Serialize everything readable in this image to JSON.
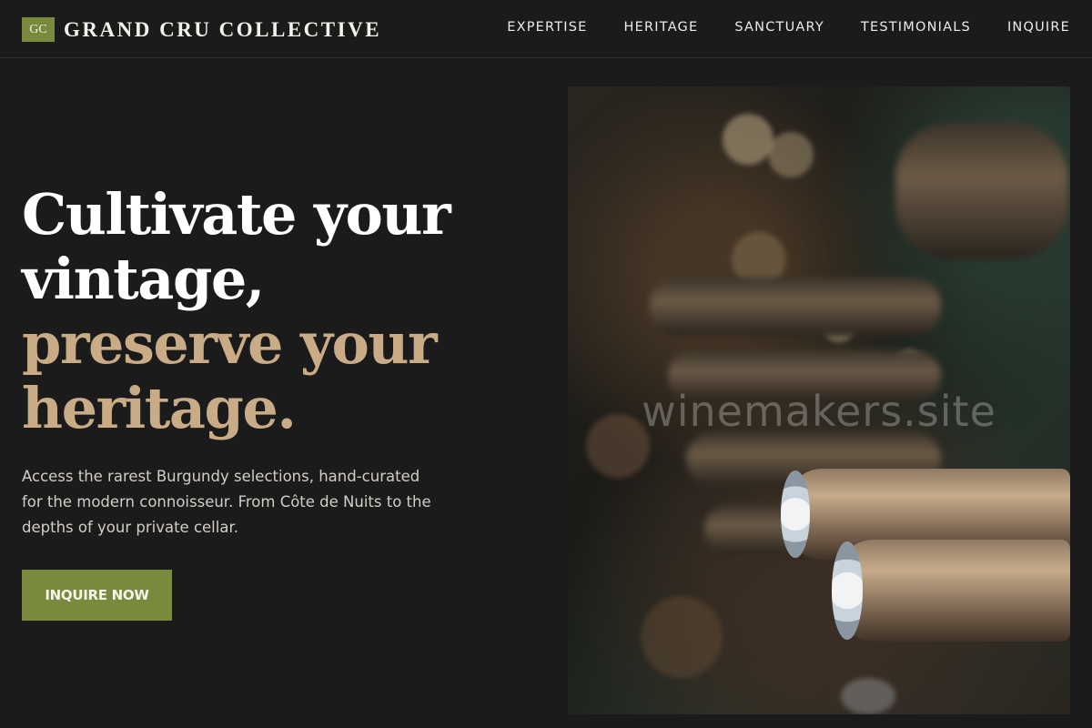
{
  "brand": {
    "logo_text": "GC",
    "name": "GRAND CRU COLLECTIVE",
    "logo_color": "#7a8a3c"
  },
  "nav": {
    "items": [
      {
        "label": "EXPERTISE"
      },
      {
        "label": "HERITAGE"
      },
      {
        "label": "SANCTUARY"
      },
      {
        "label": "TESTIMONIALS"
      },
      {
        "label": "INQUIRE"
      }
    ]
  },
  "hero": {
    "title_line1": "Cultivate your",
    "title_line2": "vintage,",
    "title_accent_line1": "preserve your",
    "title_accent_line2": "heritage.",
    "subtitle": "Access the rarest Burgundy selections, hand-curated for the modern connoisseur. From Côte de Nuits to the depths of your private cellar.",
    "cta_label": "INQUIRE NOW",
    "accent_color": "#c9ab86",
    "image_watermark": "winemakers.site",
    "image_icon": "wine-bottles-image"
  }
}
